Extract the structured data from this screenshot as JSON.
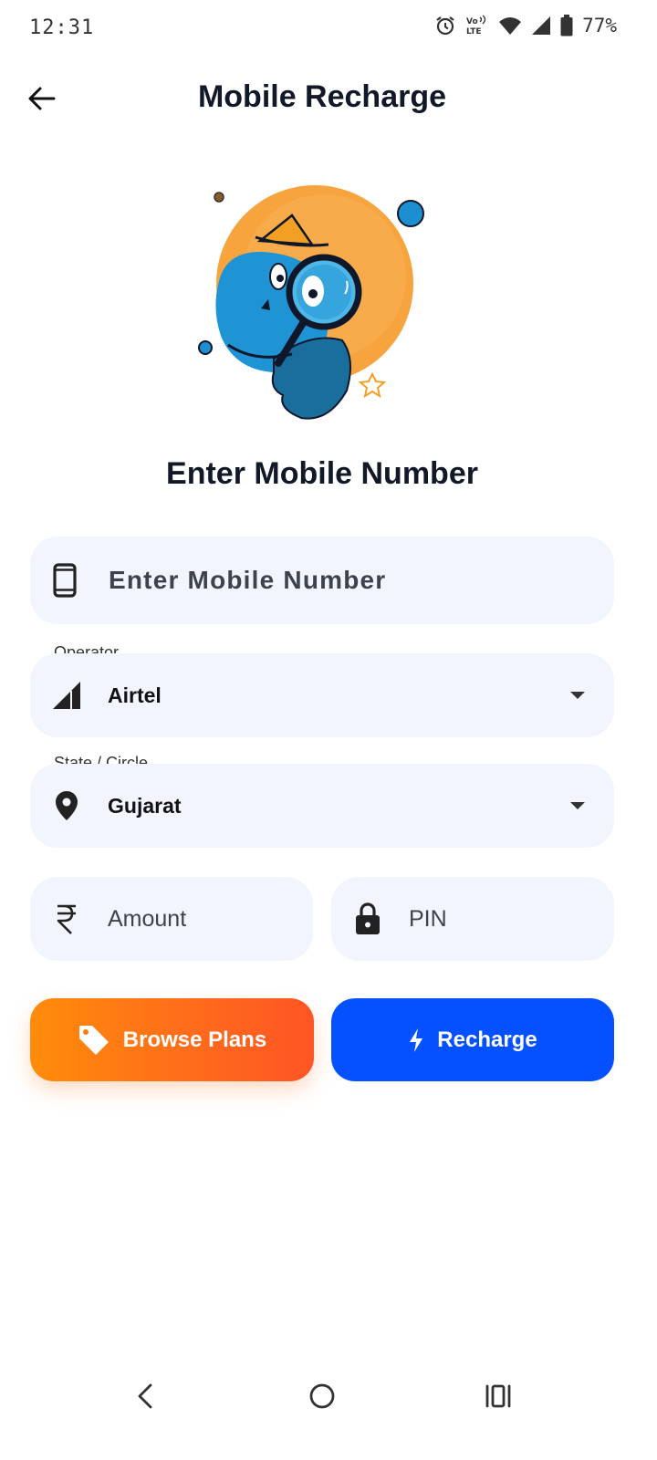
{
  "status_bar": {
    "time": "12:31",
    "battery": "77%",
    "icons": [
      "alarm-icon",
      "volte-icon",
      "wifi-icon",
      "signal-icon",
      "battery-icon"
    ]
  },
  "app_bar": {
    "title": "Mobile Recharge",
    "back_icon": "arrow-left-icon"
  },
  "illustration": {
    "description_icon": "mascot-magnifier-illustration"
  },
  "form": {
    "heading": "Enter Mobile Number",
    "mobile": {
      "placeholder": "Enter Mobile Number",
      "icon": "smartphone-icon"
    },
    "operator": {
      "label": "Operator",
      "value": "Airtel",
      "icon": "signal-cellular-icon"
    },
    "state": {
      "label": "State / Circle",
      "value": "Gujarat",
      "icon": "location-pin-icon"
    },
    "amount": {
      "placeholder": "Amount",
      "icon": "rupee-icon"
    },
    "pin": {
      "placeholder": "PIN",
      "icon": "lock-icon"
    }
  },
  "buttons": {
    "browse_plans": "Browse Plans",
    "recharge": "Recharge"
  },
  "colors": {
    "primary_blue": "#0550ff",
    "orange_start": "#ff8c0a",
    "orange_end": "#ff5524",
    "field_bg": "#f2f5fd",
    "title_text": "#111827"
  },
  "nav_bar": {
    "items": [
      "nav-back-icon",
      "nav-home-icon",
      "nav-recents-icon"
    ]
  }
}
